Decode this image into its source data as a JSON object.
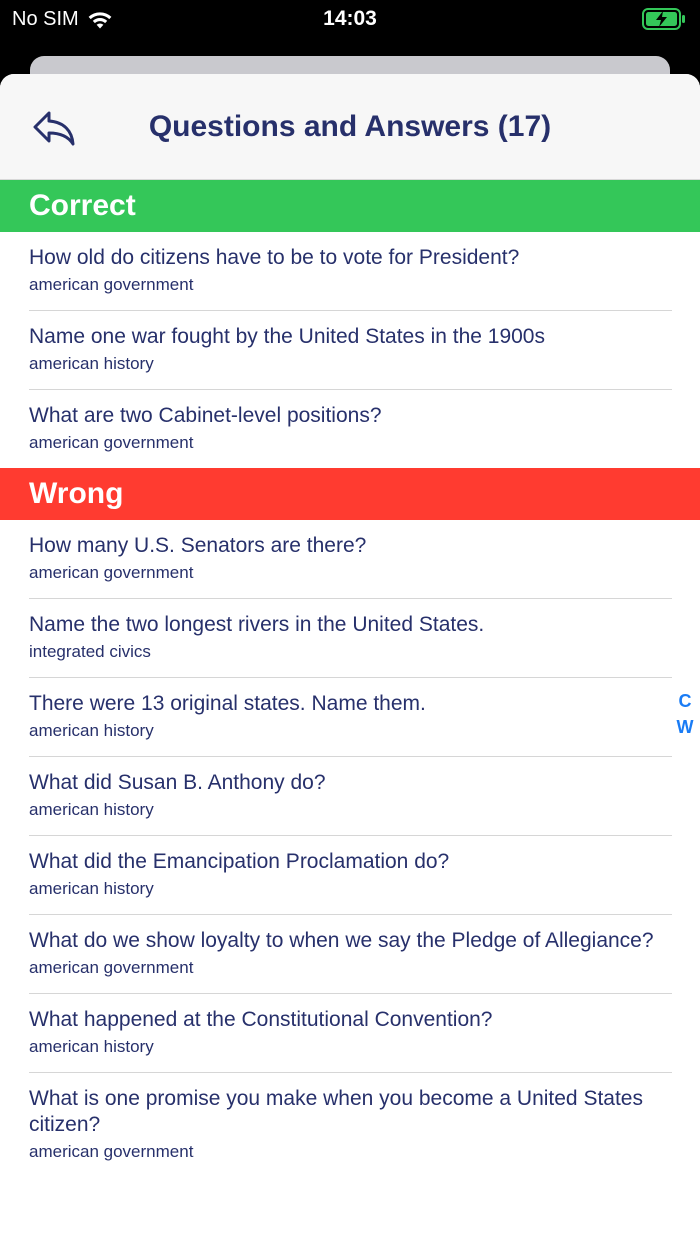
{
  "status_bar": {
    "carrier": "No SIM",
    "time": "14:03",
    "icons": [
      "wifi-icon",
      "battery-charging-icon"
    ]
  },
  "nav": {
    "title": "Questions and Answers (17)",
    "back_icon": "reply-arrow-icon"
  },
  "sections": {
    "correct": {
      "title": "Correct",
      "color": "#34c759",
      "items": [
        {
          "question": "How old do citizens have to be to vote for President?",
          "category": "american government"
        },
        {
          "question": "Name one war fought by the United States in the 1900s",
          "category": "american history"
        },
        {
          "question": "What are two Cabinet-level positions?",
          "category": "american government"
        }
      ]
    },
    "wrong": {
      "title": "Wrong",
      "color": "#ff3b30",
      "items": [
        {
          "question": "How many U.S. Senators are there?",
          "category": "american government"
        },
        {
          "question": "Name the two longest rivers in the United States.",
          "category": "integrated civics"
        },
        {
          "question": "There were 13 original states. Name them.",
          "category": "american history"
        },
        {
          "question": "What did Susan B. Anthony do?",
          "category": "american history"
        },
        {
          "question": "What did the Emancipation Proclamation do?",
          "category": "american history"
        },
        {
          "question": "What do we show loyalty to when we say the Pledge of Allegiance?",
          "category": "american government"
        },
        {
          "question": "What happened at the Constitutional Convention?",
          "category": "american history"
        },
        {
          "question": "What is one promise you make when you become a United States citizen?",
          "category": "american government"
        }
      ]
    }
  },
  "index": [
    "C",
    "W"
  ]
}
